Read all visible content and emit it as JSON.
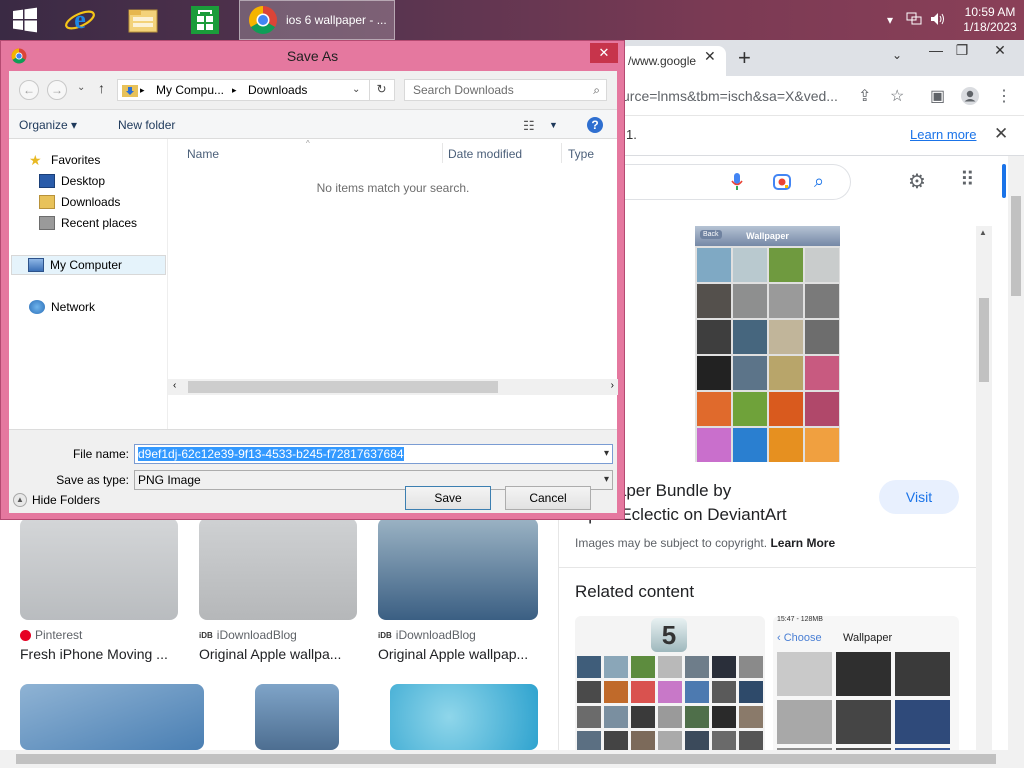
{
  "taskbar": {
    "chrome_task_label": "ios 6 wallpaper - ...",
    "clock_time": "10:59 AM",
    "clock_date": "1/18/2023"
  },
  "chrome": {
    "tab_label": "/www.google",
    "url": "urce=lnms&tbm=isch&sa=X&ved...",
    "info_text": "1.",
    "learn_more": "Learn more"
  },
  "results": [
    {
      "source": "Pinterest",
      "title": "Fresh iPhone Moving ...",
      "source_color": "#e60023"
    },
    {
      "source": "iDownloadBlog",
      "title": "Original Apple wallpa...",
      "source_color": "#333333"
    },
    {
      "source": "iDownloadBlog",
      "title": "Original Apple wallpap...",
      "source_color": "#333333"
    }
  ],
  "panel": {
    "preview_back": "Back",
    "preview_header": "Wallpaper",
    "title": "Wallpaper Bundle by OptimEclectic on DeviantArt",
    "visit": "Visit",
    "copyright_prefix": "Images may be subject to copyright.",
    "copyright_link": "Learn More",
    "related": "Related content",
    "related_badge": "5",
    "related_choose": "Choose",
    "related_wallpaper": "Wallpaper",
    "related_status": "15:47 - 128MB"
  },
  "dialog": {
    "title": "Save As",
    "close": "✕",
    "breadcrumb": [
      "My Compu...",
      "Downloads"
    ],
    "search_placeholder": "Search Downloads",
    "organize": "Organize",
    "new_folder": "New folder",
    "nav": {
      "favorites": "Favorites",
      "desktop": "Desktop",
      "downloads": "Downloads",
      "recent": "Recent places",
      "computer": "My Computer",
      "network": "Network"
    },
    "columns": [
      "Name",
      "Date modified",
      "Type"
    ],
    "empty_message": "No items match your search.",
    "file_name_label": "File name:",
    "file_name_value": "d9ef1dj-62c12e39-9f13-4533-b245-f72817637684",
    "save_type_label": "Save as type:",
    "save_type_value": "PNG Image",
    "hide_folders": "Hide Folders",
    "save": "Save",
    "cancel": "Cancel"
  },
  "colors": {
    "dialog_frame": "#e5789f",
    "selection": "#3399ff",
    "link": "#1a73e8"
  }
}
